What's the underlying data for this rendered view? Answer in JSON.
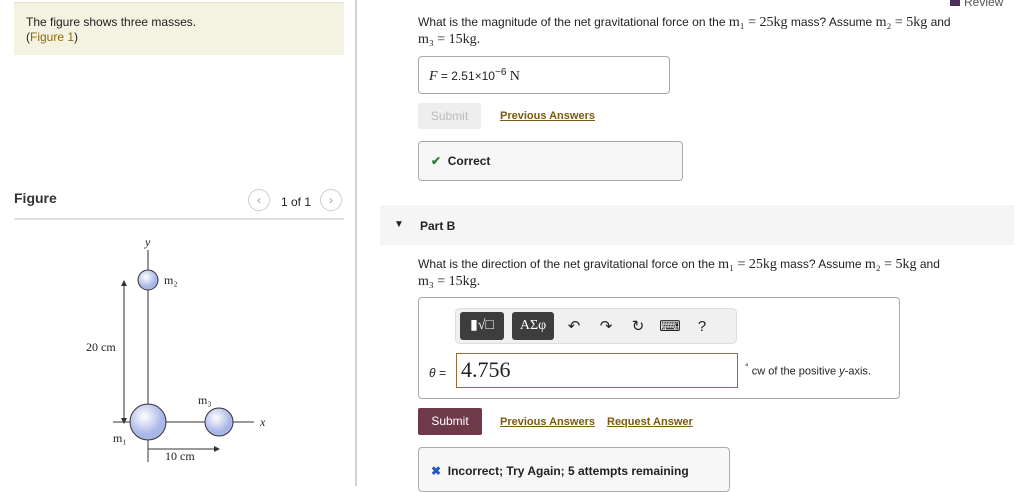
{
  "intro": {
    "text": "The figure shows three masses.",
    "figure_link": "Figure 1"
  },
  "figure": {
    "title": "Figure",
    "pager": "1 of 1",
    "labels": {
      "y": "y",
      "x": "x",
      "m1": "m₁",
      "m2": "m₂",
      "m3": "m₃",
      "d_vertical": "20 cm",
      "d_horizontal": "10 cm"
    }
  },
  "header": {
    "review": "Review"
  },
  "partA": {
    "q1": "What is the magnitude of the net gravitational force on the ",
    "m1": "m₁ = 25kg",
    "q2": " mass? Assume ",
    "m2": "m₂ = 5kg",
    "q3": " and",
    "m3": "m₃ = 15kg.",
    "var": "F",
    "eq": "=",
    "value": "2.51×10",
    "exp": "−6",
    "unit": "N",
    "submit": "Submit",
    "previous": "Previous Answers",
    "feedback": "Correct"
  },
  "partB": {
    "title": "Part B",
    "q1": "What is the direction of the net gravitational force on the ",
    "m1": "m₁ = 25kg",
    "q2": " mass? Assume ",
    "m2": "m₂ = 5kg",
    "q3": " and",
    "m3": "m₃ = 15kg.",
    "tool_greek": "ΑΣφ",
    "help": "?",
    "var": "θ =",
    "value": "4.756",
    "unit_deg": "°",
    "unit_text": "cw of the positive ",
    "unit_axis": "y",
    "unit_tail": "-axis.",
    "submit": "Submit",
    "previous": "Previous Answers",
    "request": "Request Answer",
    "feedback": "Incorrect; Try Again; 5 attempts remaining"
  },
  "colors": {
    "submit": "#6e3a4a",
    "link": "#7a5a10",
    "correct": "#2e7d32",
    "incorrect": "#2457c5"
  }
}
